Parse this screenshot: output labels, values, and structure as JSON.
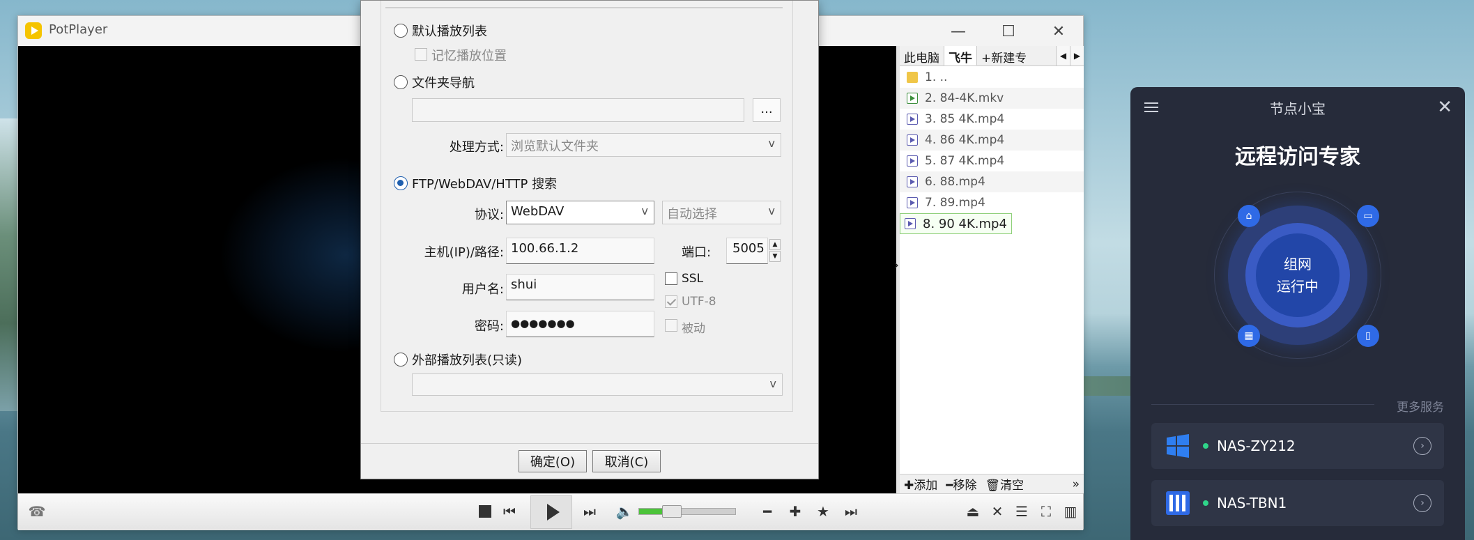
{
  "potplayer": {
    "title": "PotPlayer",
    "window_buttons": {
      "minimize": "—",
      "maximize": "☐",
      "close": "✕"
    },
    "playlist": {
      "tabs": [
        "此电脑",
        "飞牛",
        "+新建专"
      ],
      "active_tab": 1,
      "items": [
        {
          "label": "1. ..",
          "type": "folder"
        },
        {
          "label": "2. 84-4K.mkv",
          "type": "mkv"
        },
        {
          "label": "3. 85 4K.mp4",
          "type": "video"
        },
        {
          "label": "4. 86 4K.mp4",
          "type": "video"
        },
        {
          "label": "5. 87 4K.mp4",
          "type": "video"
        },
        {
          "label": "6. 88.mp4",
          "type": "video"
        },
        {
          "label": "7. 89.mp4",
          "type": "video"
        },
        {
          "label": "8. 90 4K.mp4",
          "type": "video",
          "selected": true
        }
      ],
      "footer": {
        "add": "✚添加",
        "remove": "━移除",
        "clear": "🗑清空",
        "more": "»"
      }
    },
    "controls": {
      "volume_percent": 30
    }
  },
  "dialog": {
    "options": {
      "default_playlist": "默认播放列表",
      "remember_position": "记忆播放位置",
      "folder_nav": "文件夹导航",
      "browse_btn": "...",
      "handling_label": "处理方式:",
      "handling_value": "浏览默认文件夹",
      "ftp_search": "FTP/WebDAV/HTTP 搜索",
      "protocol_label": "协议:",
      "protocol_value": "WebDAV",
      "auto_select": "自动选择",
      "host_label": "主机(IP)/路径:",
      "host_value": "100.66.1.2",
      "port_label": "端口:",
      "port_value": "5005",
      "ssl": "SSL",
      "user_label": "用户名:",
      "user_value": "shui",
      "utf8": "UTF-8",
      "password_label": "密码:",
      "password_value": "●●●●●●●",
      "passive": "被动",
      "external_playlist": "外部播放列表(只读)"
    },
    "ok_label": "确定(O)",
    "cancel_label": "取消(C)"
  },
  "node": {
    "header": "节点小宝",
    "title": "远程访问专家",
    "center_line1": "组网",
    "center_line2": "运行中",
    "more_services": "更多服务",
    "devices": [
      {
        "name": "NAS-ZY212",
        "icon": "windows-icon"
      },
      {
        "name": "NAS-TBN1",
        "icon": "nas-icon"
      }
    ]
  },
  "colors": {
    "accent": "#2f6ae6",
    "status_online": "#2fd58a",
    "panel_bg": "#262b3a"
  }
}
